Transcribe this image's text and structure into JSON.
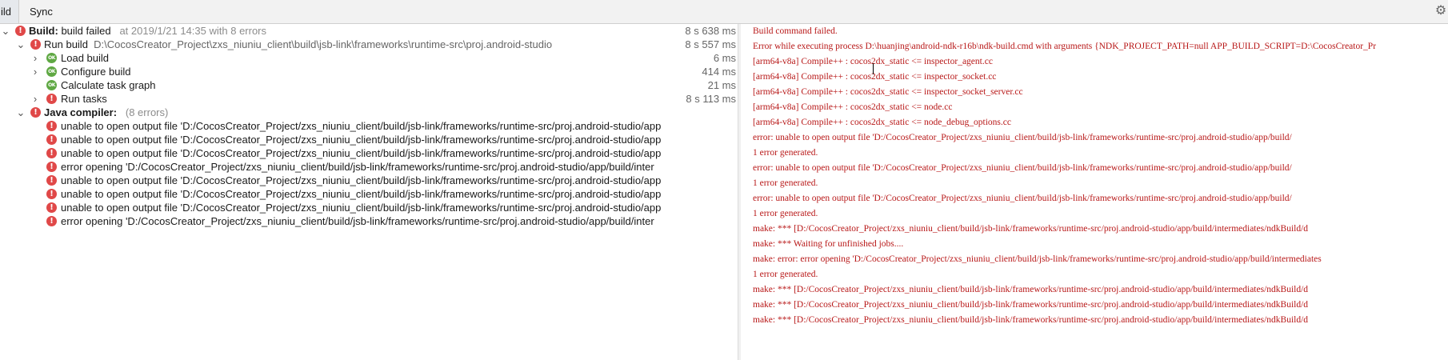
{
  "tabs": {
    "build": "ild",
    "sync": "Sync"
  },
  "icons": {
    "error": "error-icon",
    "success": "success-icon",
    "settings": "gear-icon"
  },
  "colors": {
    "error": "#e04848",
    "ok": "#5fa843",
    "console_text": "#b81818"
  },
  "tree": {
    "build": {
      "label": "Build:",
      "status": " build failed",
      "meta": "at 2019/1/21 14:35   with 8 errors",
      "time": "8 s 638 ms"
    },
    "run_build": {
      "label": "Run build",
      "path": "D:\\CocosCreator_Project\\zxs_niuniu_client\\build\\jsb-link\\frameworks\\runtime-src\\proj.android-studio",
      "time": "8 s 557 ms"
    },
    "load_build": {
      "label": "Load build",
      "time": "6 ms"
    },
    "configure_build": {
      "label": "Configure build",
      "time": "414 ms"
    },
    "calc_graph": {
      "label": "Calculate task graph",
      "time": "21 ms"
    },
    "run_tasks": {
      "label": "Run tasks",
      "time": "8 s 113 ms"
    },
    "java_compiler": {
      "label": "Java compiler:",
      "meta": "(8 errors)"
    },
    "errors": [
      "unable to open output file 'D:/CocosCreator_Project/zxs_niuniu_client/build/jsb-link/frameworks/runtime-src/proj.android-studio/app",
      "unable to open output file 'D:/CocosCreator_Project/zxs_niuniu_client/build/jsb-link/frameworks/runtime-src/proj.android-studio/app",
      "unable to open output file 'D:/CocosCreator_Project/zxs_niuniu_client/build/jsb-link/frameworks/runtime-src/proj.android-studio/app",
      "error opening 'D:/CocosCreator_Project/zxs_niuniu_client/build/jsb-link/frameworks/runtime-src/proj.android-studio/app/build/inter",
      "unable to open output file 'D:/CocosCreator_Project/zxs_niuniu_client/build/jsb-link/frameworks/runtime-src/proj.android-studio/app",
      "unable to open output file 'D:/CocosCreator_Project/zxs_niuniu_client/build/jsb-link/frameworks/runtime-src/proj.android-studio/app",
      "unable to open output file 'D:/CocosCreator_Project/zxs_niuniu_client/build/jsb-link/frameworks/runtime-src/proj.android-studio/app",
      "error opening 'D:/CocosCreator_Project/zxs_niuniu_client/build/jsb-link/frameworks/runtime-src/proj.android-studio/app/build/inter"
    ]
  },
  "console": {
    "lines": [
      "Build command failed.",
      "Error while executing process D:\\huanjing\\android-ndk-r16b\\ndk-build.cmd with arguments {NDK_PROJECT_PATH=null APP_BUILD_SCRIPT=D:\\CocosCreator_Pr",
      "[arm64-v8a] Compile++      : cocos2dx_static <= inspector_agent.cc",
      "[arm64-v8a] Compile++      : cocos2dx_static <= inspector_socket.cc",
      "[arm64-v8a] Compile++      : cocos2dx_static <= inspector_socket_server.cc",
      "[arm64-v8a] Compile++      : cocos2dx_static <= node.cc",
      "[arm64-v8a] Compile++      : cocos2dx_static <= node_debug_options.cc",
      "error: unable to open output file 'D:/CocosCreator_Project/zxs_niuniu_client/build/jsb-link/frameworks/runtime-src/proj.android-studio/app/build/",
      "1 error generated.",
      "error: unable to open output file 'D:/CocosCreator_Project/zxs_niuniu_client/build/jsb-link/frameworks/runtime-src/proj.android-studio/app/build/",
      "1 error generated.",
      "error: unable to open output file 'D:/CocosCreator_Project/zxs_niuniu_client/build/jsb-link/frameworks/runtime-src/proj.android-studio/app/build/",
      "1 error generated.",
      "make: *** [D:/CocosCreator_Project/zxs_niuniu_client/build/jsb-link/frameworks/runtime-src/proj.android-studio/app/build/intermediates/ndkBuild/d",
      "make: *** Waiting for unfinished jobs....",
      "make: error: error opening 'D:/CocosCreator_Project/zxs_niuniu_client/build/jsb-link/frameworks/runtime-src/proj.android-studio/app/build/intermediates",
      "1 error generated.",
      "make: *** [D:/CocosCreator_Project/zxs_niuniu_client/build/jsb-link/frameworks/runtime-src/proj.android-studio/app/build/intermediates/ndkBuild/d",
      "make: *** [D:/CocosCreator_Project/zxs_niuniu_client/build/jsb-link/frameworks/runtime-src/proj.android-studio/app/build/intermediates/ndkBuild/d",
      "make: *** [D:/CocosCreator_Project/zxs_niuniu_client/build/jsb-link/frameworks/runtime-src/proj.android-studio/app/build/intermediates/ndkBuild/d"
    ]
  }
}
